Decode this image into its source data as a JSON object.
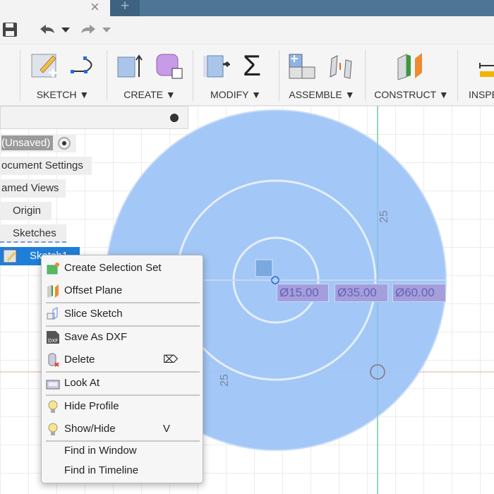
{
  "tabs": {
    "close_icon": "×",
    "new_tab": "+"
  },
  "quick_access": {
    "save": "save-icon",
    "undo": "undo-icon",
    "redo": "redo-icon"
  },
  "ribbon": {
    "groups": [
      {
        "label": "SKETCH ▼"
      },
      {
        "label": "CREATE ▼"
      },
      {
        "label": "MODIFY ▼"
      },
      {
        "label": "ASSEMBLE ▼"
      },
      {
        "label": "CONSTRUCT ▼"
      },
      {
        "label": "INSPE"
      }
    ],
    "sigma": "Σ"
  },
  "browser": {
    "items": [
      {
        "label": "(Unsaved)"
      },
      {
        "label": "ocument Settings"
      },
      {
        "label": "amed Views"
      },
      {
        "label": "Origin"
      },
      {
        "label": "Sketches"
      },
      {
        "label": "Sketch1"
      }
    ]
  },
  "context_menu": {
    "items": [
      {
        "label": "Create Selection Set"
      },
      {
        "label": "Offset Plane"
      },
      {
        "label": "Slice Sketch"
      },
      {
        "label": "Save As DXF"
      },
      {
        "label": "Delete",
        "shortcut": "⌦"
      },
      {
        "label": "Look At"
      },
      {
        "label": "Hide Profile"
      },
      {
        "label": "Show/Hide",
        "shortcut": "V"
      },
      {
        "label": "Find in Window"
      },
      {
        "label": "Find in Timeline"
      }
    ]
  },
  "sketch": {
    "dimensions": [
      "Ø15.00",
      "Ø35.00",
      "Ø60.00"
    ],
    "radius_labels": [
      "25",
      "25"
    ],
    "profile_color": "#9ec4f7",
    "dimension_color": "#a49fdc"
  }
}
